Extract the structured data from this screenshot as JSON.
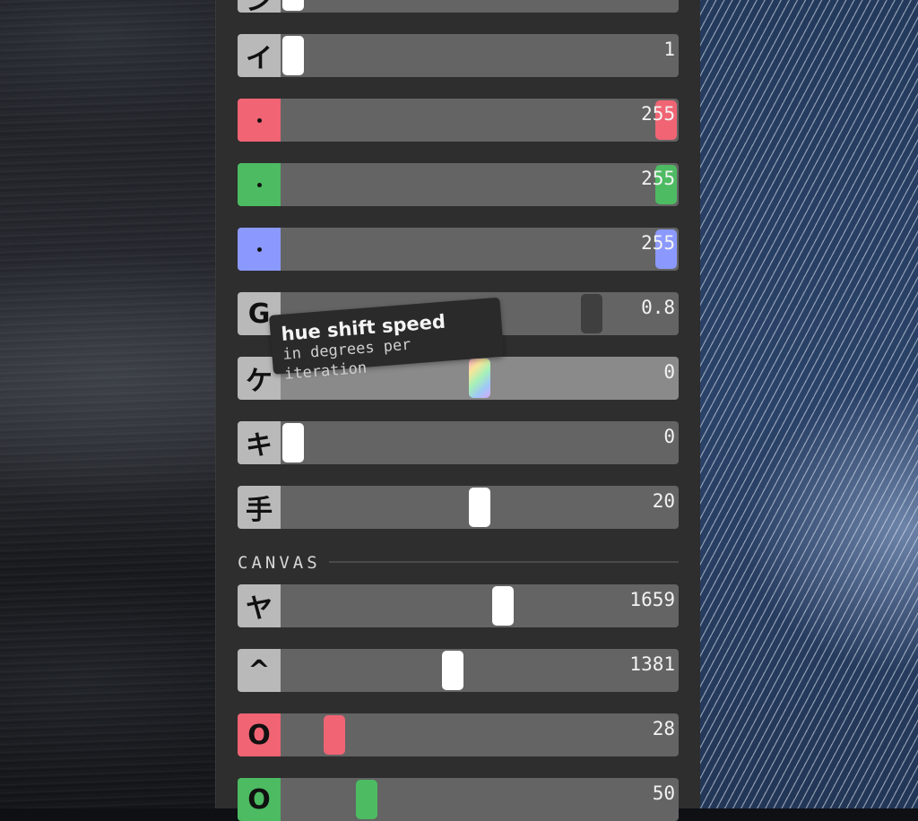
{
  "colors": {
    "panel": "#2e2e2e",
    "icon_box": "#b9b9b9",
    "track": "#646464",
    "thumb_default": "#ffffff",
    "red": "#f06474",
    "green": "#4dbb62",
    "blue": "#8b99ff"
  },
  "sliders": [
    {
      "icon": "glyph-top-icon",
      "glyph": "ン",
      "value": "",
      "thumb": "white"
    },
    {
      "icon": "glyph-one-icon",
      "glyph": "イ",
      "value": "1",
      "thumb": "white"
    },
    {
      "icon": "red-dot-icon",
      "glyph": "•",
      "value": "255",
      "thumb": "red"
    },
    {
      "icon": "green-dot-icon",
      "glyph": "•",
      "value": "255",
      "thumb": "green"
    },
    {
      "icon": "blue-dot-icon",
      "glyph": "•",
      "value": "255",
      "thumb": "blue"
    },
    {
      "icon": "loop-icon",
      "glyph": "G",
      "value": "0.8",
      "thumb": "dark"
    },
    {
      "icon": "ke-icon",
      "glyph": "ケ",
      "value": "0",
      "thumb": "rainbow"
    },
    {
      "icon": "ki-icon",
      "glyph": "キ",
      "value": "0",
      "thumb": "white"
    },
    {
      "icon": "te-icon",
      "glyph": "手",
      "value": "20",
      "thumb": "white"
    }
  ],
  "canvas": {
    "section_label": "CANVAS",
    "sliders": [
      {
        "icon": "width-icon",
        "glyph": "ヤ",
        "value": "1659",
        "thumb": "white"
      },
      {
        "icon": "height-icon",
        "glyph": "^",
        "value": "1381",
        "thumb": "white"
      },
      {
        "icon": "circle-red-icon",
        "glyph": "O",
        "value": "28",
        "thumb": "red"
      },
      {
        "icon": "circle-green-icon",
        "glyph": "O",
        "value": "50",
        "thumb": "green"
      }
    ]
  },
  "tooltip": {
    "title": "hue shift speed",
    "subtitle": "in degrees per iteration"
  }
}
